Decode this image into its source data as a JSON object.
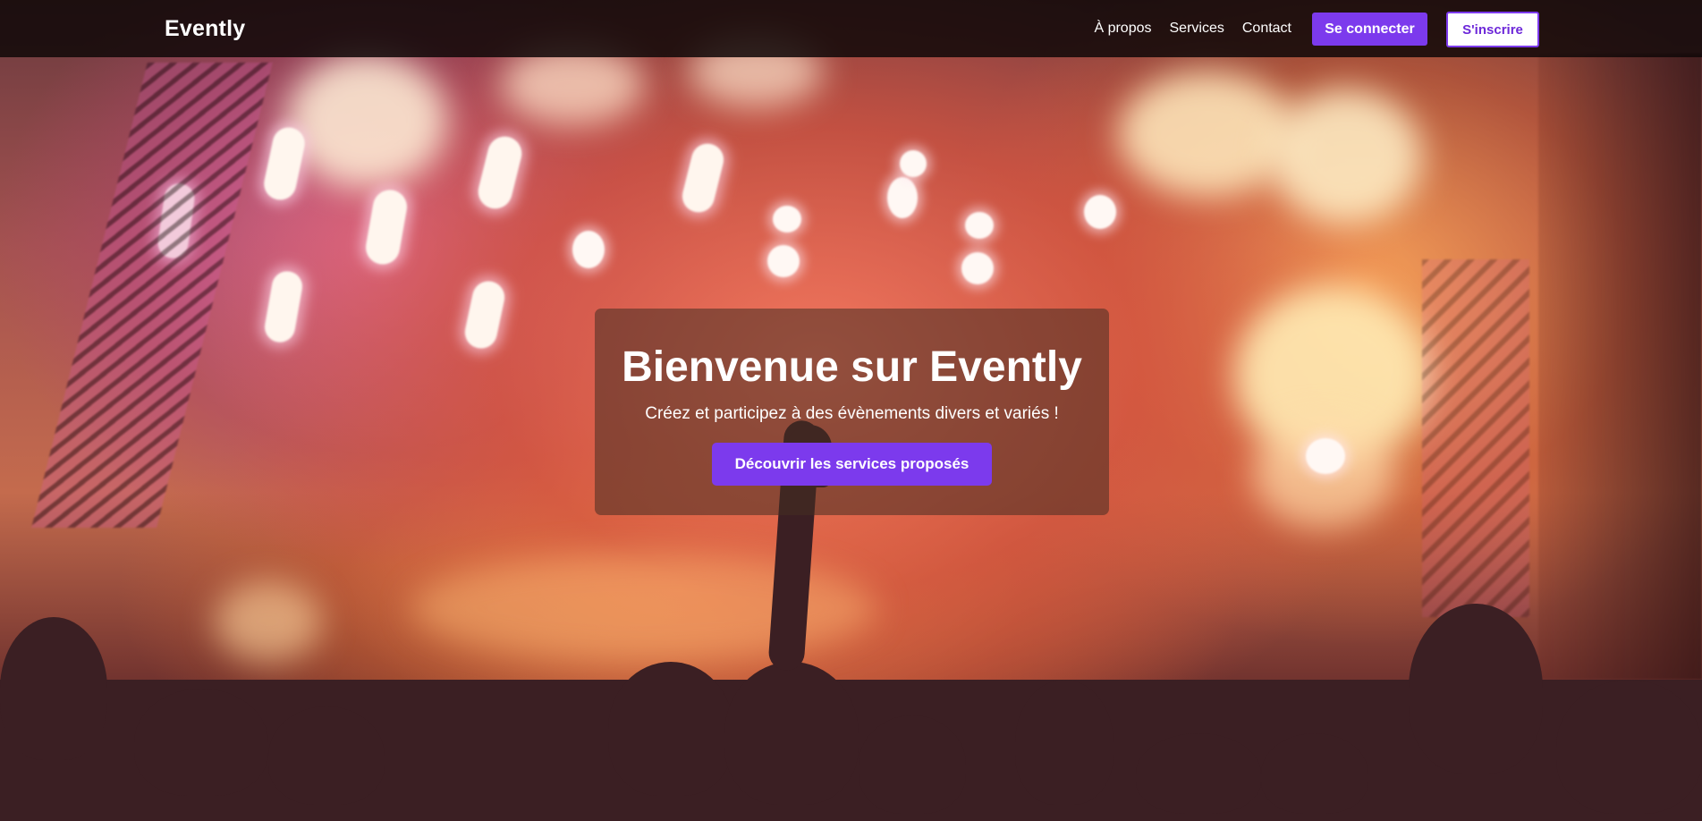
{
  "navbar": {
    "brand": "Evently",
    "links": [
      "À propos",
      "Services",
      "Contact"
    ],
    "login_label": "Se connecter",
    "signup_label": "S'inscrire"
  },
  "hero": {
    "title": "Bienvenue sur Evently",
    "subtitle": "Créez et participez à des évènements divers et variés !",
    "cta_label": "Découvrir les services proposés",
    "background": "concert-crowd-photo"
  },
  "colors": {
    "accent": "#7c3aed",
    "navbar_bg": "#100808",
    "text_on_dark": "#ffffff"
  }
}
